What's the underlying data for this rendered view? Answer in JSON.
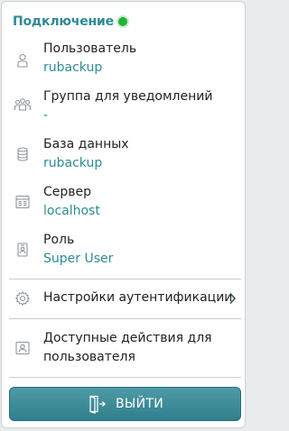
{
  "header": {
    "title": "Подключение",
    "status_color": "#1fb33a"
  },
  "items": [
    {
      "icon": "user-icon",
      "label": "Пользователь",
      "value": "rubackup"
    },
    {
      "icon": "users-group-icon",
      "label": "Группа для уведомлений",
      "value": "-"
    },
    {
      "icon": "database-icon",
      "label": "База данных",
      "value": "rubackup"
    },
    {
      "icon": "server-icon",
      "label": "Сервер",
      "value": "localhost"
    },
    {
      "icon": "role-badge-icon",
      "label": "Роль",
      "value": "Super User"
    }
  ],
  "auth_settings": {
    "icon": "gear-icon",
    "label": "Настройки аутентификации",
    "arrow_icon": "chevron-right-icon"
  },
  "user_actions": {
    "icon": "user-card-icon",
    "label_line1": "Доступные действия для",
    "label_line2": "пользователя"
  },
  "logout": {
    "icon": "logout-door-icon",
    "label": "ВЫЙТИ"
  },
  "colors": {
    "accent": "#2f8a97",
    "button_top": "#4f9aa6",
    "button_bottom": "#2f7f8c"
  }
}
